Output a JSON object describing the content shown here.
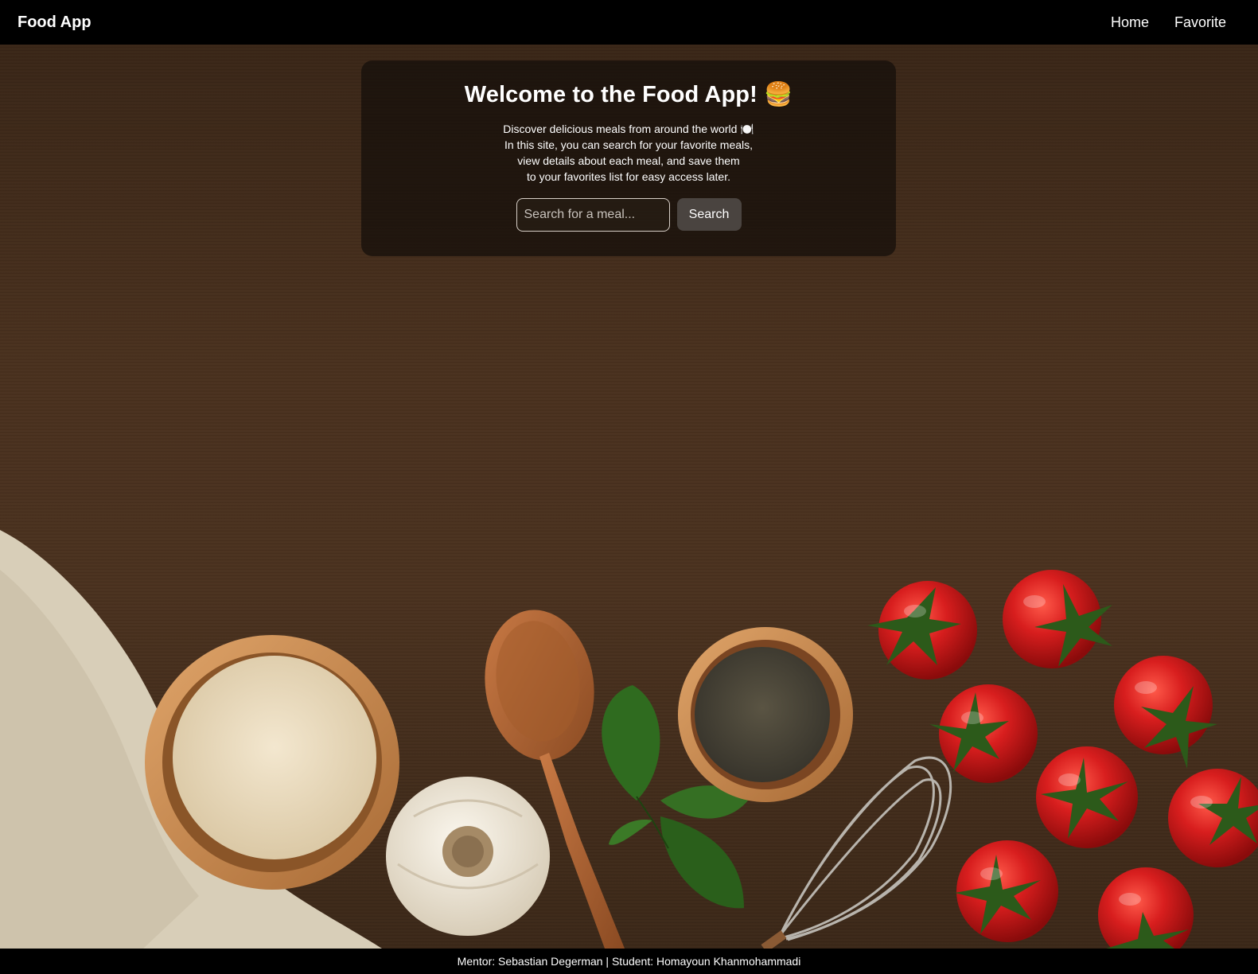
{
  "navbar": {
    "brand": "Food App",
    "links": [
      {
        "label": "Home"
      },
      {
        "label": "Favorite"
      }
    ]
  },
  "hero": {
    "title": "Welcome to the Food App! 🍔",
    "description_lines": [
      "Discover delicious meals from around the world 🍽️",
      "In this site, you can search for your favorite meals,",
      "view details about each meal, and save them",
      "to your favorites list for easy access later."
    ],
    "search": {
      "placeholder": "Search for a meal...",
      "value": "",
      "button_label": "Search"
    }
  },
  "background": {
    "items": [
      "cloth",
      "rice-bowl",
      "garlic",
      "wooden-spoon",
      "basil",
      "pepper-bowl",
      "whisk",
      "cherry-tomatoes"
    ],
    "colors": {
      "wood": "#4a311e",
      "tomato": "#c4161c",
      "basil": "#2f6b1f"
    }
  },
  "footer": {
    "text": "Mentor: Sebastian Degerman | Student: Homayoun Khanmohammadi"
  }
}
